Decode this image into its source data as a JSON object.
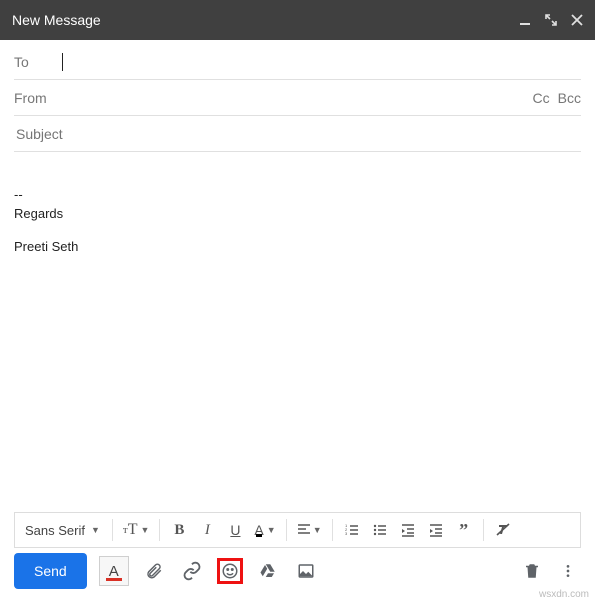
{
  "window": {
    "title": "New Message"
  },
  "fields": {
    "to_label": "To",
    "from_label": "From",
    "subject_placeholder": "Subject",
    "cc": "Cc",
    "bcc": "Bcc"
  },
  "body": {
    "signature_divider": "--",
    "signature_line1": "Regards",
    "signature_line2": "Preeti Seth"
  },
  "format": {
    "font": "Sans Serif"
  },
  "actions": {
    "send": "Send"
  },
  "watermark": "wsxdn.com"
}
